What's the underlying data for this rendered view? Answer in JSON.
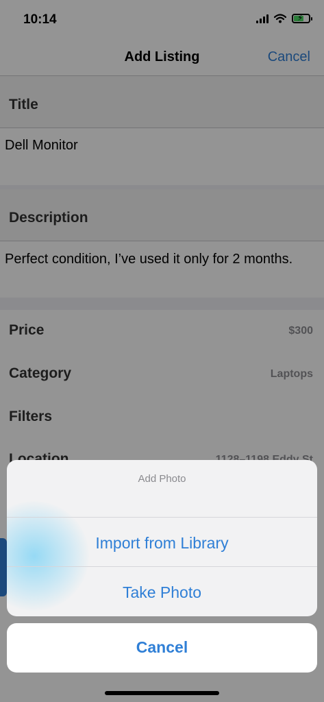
{
  "status_bar": {
    "time": "10:14"
  },
  "nav": {
    "title": "Add Listing",
    "cancel_label": "Cancel"
  },
  "form": {
    "title": {
      "label": "Title",
      "value": "Dell Monitor"
    },
    "description": {
      "label": "Description",
      "value": "Perfect condition, I’ve used it only for 2 months."
    },
    "price": {
      "label": "Price",
      "value": "$300"
    },
    "category": {
      "label": "Category",
      "value": "Laptops"
    },
    "filters": {
      "label": "Filters"
    },
    "location": {
      "label": "Location",
      "value": "1128–1198 Eddy St"
    }
  },
  "action_sheet": {
    "title": "Add Photo",
    "import_label": "Import from Library",
    "take_photo_label": "Take Photo",
    "cancel_label": "Cancel"
  },
  "colors": {
    "accent": "#2f7fd6",
    "battery": "#4cd964"
  }
}
